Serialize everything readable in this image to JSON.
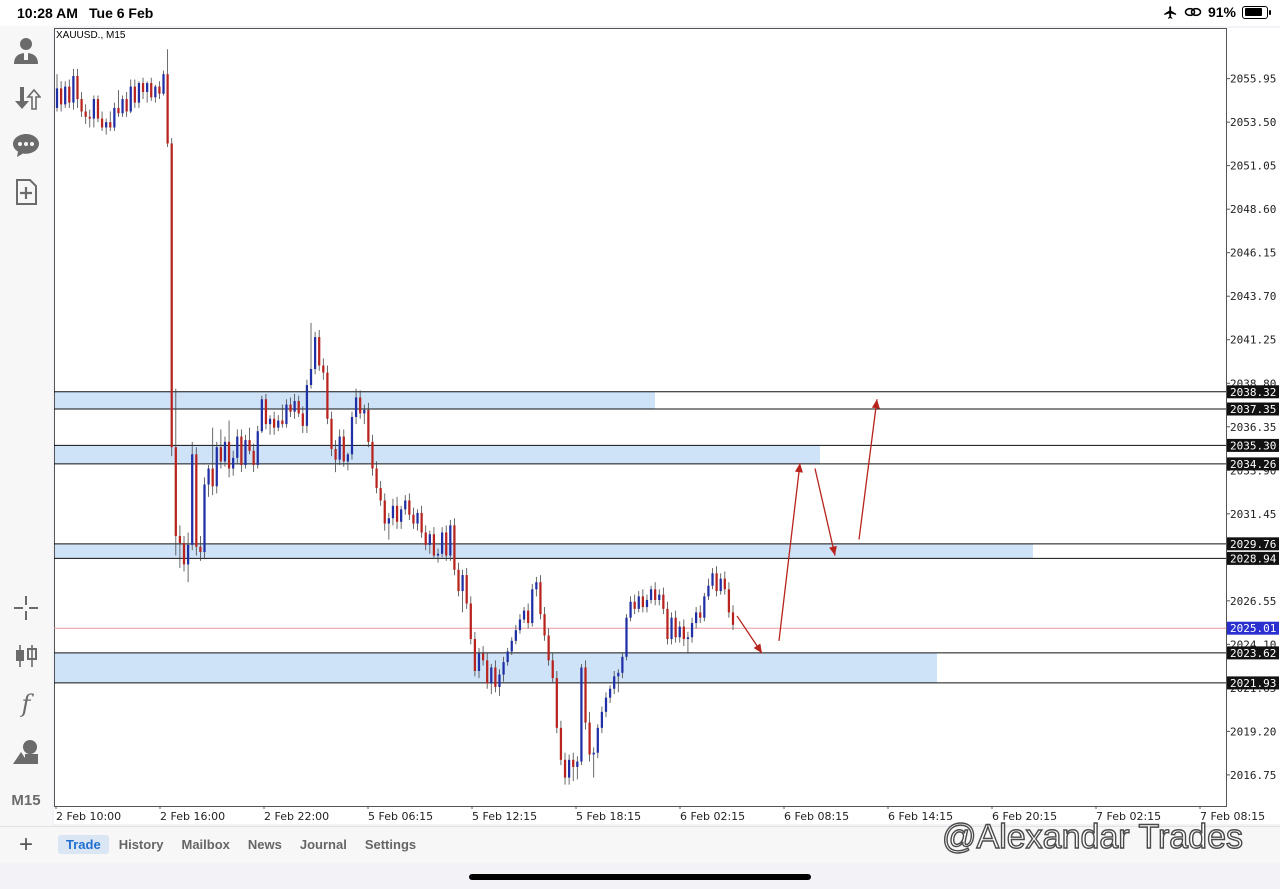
{
  "status_bar": {
    "time": "10:28 AM",
    "date": "Tue 6 Feb",
    "battery": "91%",
    "battery_level": 0.91
  },
  "sidebar": {
    "icons": [
      "account-icon",
      "trade-up-down-icon",
      "chat-icon",
      "new-order-icon",
      "crosshair-icon",
      "candles-icon",
      "indicators-icon",
      "objects-icon"
    ],
    "indicator_glyph": "f",
    "timeframe": "M15"
  },
  "chart_title": "XAUUSD., M15",
  "bottom_bar": {
    "plus": "+",
    "tabs": [
      "Trade",
      "History",
      "Mailbox",
      "News",
      "Journal",
      "Settings"
    ],
    "active_tab": "Trade"
  },
  "watermark": "@Alexandar Trades",
  "chart_data": {
    "type": "candlestick",
    "symbol": "XAUUSD., M15",
    "ylim": [
      2015.0,
      2058.8
    ],
    "y_ticks": [
      "2055.95",
      "2053.50",
      "2051.05",
      "2048.60",
      "2046.15",
      "2043.70",
      "2041.25",
      "2038.80",
      "2036.35",
      "2033.90",
      "2031.45",
      "2026.55",
      "2024.10",
      "2021.65",
      "2019.20",
      "2016.75"
    ],
    "x_ticks": [
      "2 Feb 10:00",
      "2 Feb 16:00",
      "2 Feb 22:00",
      "5 Feb 06:15",
      "5 Feb 12:15",
      "5 Feb 18:15",
      "6 Feb 02:15",
      "6 Feb 08:15",
      "6 Feb 14:15",
      "6 Feb 20:15",
      "7 Feb 02:15",
      "7 Feb 08:15"
    ],
    "current_price": 2025.01,
    "level_labels": [
      "2038.32",
      "2037.35",
      "2035.30",
      "2034.26",
      "2029.76",
      "2028.94",
      "2025.01",
      "2023.62",
      "2021.93"
    ],
    "zones": [
      {
        "top": 2038.32,
        "bottom": 2037.35
      },
      {
        "top": 2035.3,
        "bottom": 2034.26
      },
      {
        "top": 2029.76,
        "bottom": 2028.94
      },
      {
        "top": 2023.62,
        "bottom": 2021.93
      }
    ],
    "projected_path": [
      2025.7,
      2023.6,
      2024.3,
      2034.3,
      2031.1,
      2038.1
    ],
    "colors": {
      "bull": "#1f2fa6",
      "bear": "#b8231d",
      "zone": "#cfe3f8",
      "arrow": "#b8231d",
      "price_line": "#e79aa2",
      "price_badge": "#2b2fd0"
    },
    "candles": [
      [
        2054.3,
        2056.2,
        2054.1,
        2055.4
      ],
      [
        2055.4,
        2055.8,
        2054.1,
        2054.5
      ],
      [
        2054.5,
        2055.8,
        2054.3,
        2055.5
      ],
      [
        2055.5,
        2055.9,
        2054.3,
        2054.6
      ],
      [
        2054.6,
        2056.5,
        2054.2,
        2056.1
      ],
      [
        2056.1,
        2056.5,
        2054.3,
        2054.8
      ],
      [
        2054.8,
        2055.2,
        2053.8,
        2054.1
      ],
      [
        2054.1,
        2054.5,
        2053.4,
        2053.8
      ],
      [
        2053.8,
        2054.2,
        2053.2,
        2053.7
      ],
      [
        2053.7,
        2055.0,
        2053.2,
        2054.8
      ],
      [
        2054.8,
        2055.0,
        2053.5,
        2053.7
      ],
      [
        2053.7,
        2054.1,
        2053.0,
        2053.2
      ],
      [
        2053.2,
        2053.7,
        2052.8,
        2053.5
      ],
      [
        2053.5,
        2054.1,
        2053.0,
        2053.2
      ],
      [
        2053.2,
        2054.6,
        2053.0,
        2054.3
      ],
      [
        2054.3,
        2055.3,
        2053.8,
        2054.0
      ],
      [
        2054.0,
        2055.0,
        2053.8,
        2054.8
      ],
      [
        2054.8,
        2055.2,
        2053.8,
        2054.1
      ],
      [
        2054.1,
        2055.9,
        2054.0,
        2055.5
      ],
      [
        2055.5,
        2055.9,
        2054.3,
        2054.6
      ],
      [
        2054.6,
        2055.8,
        2054.3,
        2055.7
      ],
      [
        2055.7,
        2056.0,
        2054.8,
        2055.2
      ],
      [
        2055.2,
        2055.8,
        2054.6,
        2055.7
      ],
      [
        2055.7,
        2056.0,
        2054.7,
        2054.9
      ],
      [
        2054.9,
        2055.6,
        2054.6,
        2055.5
      ],
      [
        2055.5,
        2055.8,
        2054.8,
        2055.1
      ],
      [
        2055.1,
        2056.4,
        2055.0,
        2056.2
      ],
      [
        2056.2,
        2057.6,
        2052.1,
        2052.3
      ],
      [
        2052.3,
        2052.6,
        2034.7,
        2035.2
      ],
      [
        2035.2,
        2038.5,
        2029.1,
        2030.2
      ],
      [
        2030.2,
        2030.8,
        2028.4,
        2029.8
      ],
      [
        2029.8,
        2030.2,
        2028.2,
        2028.6
      ],
      [
        2028.6,
        2030.4,
        2027.6,
        2029.7
      ],
      [
        2029.7,
        2035.5,
        2029.4,
        2034.8
      ],
      [
        2034.8,
        2035.2,
        2029.1,
        2029.6
      ],
      [
        2029.6,
        2030.2,
        2028.8,
        2029.3
      ],
      [
        2029.3,
        2033.5,
        2028.9,
        2033.1
      ],
      [
        2033.1,
        2034.2,
        2032.4,
        2034.0
      ],
      [
        2034.0,
        2036.3,
        2032.5,
        2033.0
      ],
      [
        2033.0,
        2035.5,
        2032.6,
        2035.2
      ],
      [
        2035.2,
        2036.2,
        2034.0,
        2034.4
      ],
      [
        2034.4,
        2035.8,
        2034.1,
        2035.5
      ],
      [
        2035.5,
        2036.7,
        2033.5,
        2034.0
      ],
      [
        2034.0,
        2035.0,
        2033.6,
        2034.6
      ],
      [
        2034.6,
        2036.2,
        2034.3,
        2035.8
      ],
      [
        2035.8,
        2036.2,
        2033.8,
        2034.2
      ],
      [
        2034.2,
        2035.9,
        2034.0,
        2035.6
      ],
      [
        2035.6,
        2036.3,
        2034.8,
        2035.0
      ],
      [
        2035.0,
        2035.4,
        2033.8,
        2034.2
      ],
      [
        2034.2,
        2036.4,
        2034.0,
        2036.1
      ],
      [
        2036.1,
        2038.1,
        2036.0,
        2037.9
      ],
      [
        2037.9,
        2038.2,
        2036.2,
        2036.5
      ],
      [
        2036.5,
        2037.0,
        2035.9,
        2036.8
      ],
      [
        2036.8,
        2037.2,
        2035.9,
        2036.3
      ],
      [
        2036.3,
        2037.0,
        2036.1,
        2036.7
      ],
      [
        2036.7,
        2037.6,
        2036.3,
        2036.5
      ],
      [
        2036.5,
        2037.9,
        2036.3,
        2037.6
      ],
      [
        2037.6,
        2038.0,
        2036.9,
        2037.2
      ],
      [
        2037.2,
        2038.2,
        2036.8,
        2037.8
      ],
      [
        2037.8,
        2038.1,
        2036.9,
        2037.1
      ],
      [
        2037.1,
        2037.5,
        2036.0,
        2036.4
      ],
      [
        2036.4,
        2039.0,
        2036.0,
        2038.7
      ],
      [
        2038.7,
        2042.2,
        2038.5,
        2039.6
      ],
      [
        2039.6,
        2041.7,
        2039.3,
        2041.4
      ],
      [
        2041.4,
        2041.8,
        2039.5,
        2039.8
      ],
      [
        2039.8,
        2040.2,
        2039.0,
        2039.4
      ],
      [
        2039.4,
        2039.8,
        2036.5,
        2036.8
      ],
      [
        2036.8,
        2037.2,
        2034.7,
        2035.1
      ],
      [
        2035.1,
        2035.6,
        2033.8,
        2034.5
      ],
      [
        2034.5,
        2036.2,
        2034.2,
        2035.8
      ],
      [
        2035.8,
        2036.2,
        2034.1,
        2034.4
      ],
      [
        2034.4,
        2034.9,
        2033.9,
        2034.8
      ],
      [
        2034.8,
        2037.2,
        2034.5,
        2036.9
      ],
      [
        2036.9,
        2038.5,
        2036.5,
        2038.0
      ],
      [
        2038.0,
        2038.4,
        2036.8,
        2037.1
      ],
      [
        2037.1,
        2037.6,
        2036.5,
        2037.3
      ],
      [
        2037.3,
        2037.7,
        2035.2,
        2035.5
      ],
      [
        2035.5,
        2035.9,
        2033.6,
        2034.0
      ],
      [
        2034.0,
        2034.4,
        2032.6,
        2032.9
      ],
      [
        2032.9,
        2033.3,
        2031.9,
        2032.2
      ],
      [
        2032.2,
        2032.6,
        2030.5,
        2030.9
      ],
      [
        2030.9,
        2031.5,
        2030.0,
        2031.2
      ],
      [
        2031.2,
        2032.3,
        2030.8,
        2031.9
      ],
      [
        2031.9,
        2032.4,
        2030.6,
        2031.0
      ],
      [
        2031.0,
        2031.9,
        2030.6,
        2031.7
      ],
      [
        2031.7,
        2032.5,
        2031.4,
        2032.2
      ],
      [
        2032.2,
        2032.6,
        2031.1,
        2031.4
      ],
      [
        2031.4,
        2031.8,
        2030.6,
        2030.9
      ],
      [
        2030.9,
        2031.7,
        2030.5,
        2031.5
      ],
      [
        2031.5,
        2031.9,
        2030.1,
        2030.4
      ],
      [
        2030.4,
        2030.8,
        2029.4,
        2029.7
      ],
      [
        2029.7,
        2030.5,
        2029.2,
        2030.3
      ],
      [
        2030.3,
        2030.7,
        2028.9,
        2029.1
      ],
      [
        2029.1,
        2029.5,
        2028.7,
        2029.2
      ],
      [
        2029.2,
        2030.7,
        2029.0,
        2030.4
      ],
      [
        2030.4,
        2030.8,
        2028.8,
        2029.1
      ],
      [
        2029.1,
        2031.1,
        2028.8,
        2030.8
      ],
      [
        2030.8,
        2031.2,
        2028.0,
        2028.3
      ],
      [
        2028.3,
        2028.7,
        2026.8,
        2027.1
      ],
      [
        2027.1,
        2028.3,
        2025.9,
        2028.0
      ],
      [
        2028.0,
        2028.4,
        2026.1,
        2026.4
      ],
      [
        2026.4,
        2026.8,
        2024.1,
        2024.4
      ],
      [
        2024.4,
        2024.8,
        2022.3,
        2022.6
      ],
      [
        2022.6,
        2023.9,
        2022.2,
        2023.6
      ],
      [
        2023.6,
        2024.0,
        2022.9,
        2023.2
      ],
      [
        2023.2,
        2023.6,
        2021.6,
        2021.9
      ],
      [
        2021.9,
        2023.0,
        2021.3,
        2022.8
      ],
      [
        2022.8,
        2023.2,
        2021.4,
        2021.7
      ],
      [
        2021.7,
        2022.7,
        2021.2,
        2022.4
      ],
      [
        2022.4,
        2023.4,
        2022.0,
        2023.1
      ],
      [
        2023.1,
        2023.9,
        2022.9,
        2023.7
      ],
      [
        2023.7,
        2024.5,
        2023.5,
        2024.3
      ],
      [
        2024.3,
        2025.2,
        2024.1,
        2024.9
      ],
      [
        2024.9,
        2025.8,
        2024.7,
        2025.5
      ],
      [
        2025.5,
        2026.2,
        2025.3,
        2026.0
      ],
      [
        2026.0,
        2026.4,
        2025.0,
        2025.3
      ],
      [
        2025.3,
        2027.5,
        2025.1,
        2027.2
      ],
      [
        2027.2,
        2027.9,
        2026.8,
        2027.6
      ],
      [
        2027.6,
        2028.0,
        2025.5,
        2025.8
      ],
      [
        2025.8,
        2026.2,
        2024.3,
        2024.6
      ],
      [
        2024.6,
        2025.0,
        2022.9,
        2023.2
      ],
      [
        2023.2,
        2023.6,
        2021.9,
        2022.2
      ],
      [
        2022.2,
        2022.6,
        2019.1,
        2019.4
      ],
      [
        2019.4,
        2019.8,
        2017.3,
        2017.6
      ],
      [
        2017.6,
        2018.0,
        2016.2,
        2016.6
      ],
      [
        2016.6,
        2017.9,
        2016.2,
        2017.6
      ],
      [
        2017.6,
        2018.0,
        2016.4,
        2017.2
      ],
      [
        2017.2,
        2017.8,
        2016.5,
        2017.5
      ],
      [
        2017.5,
        2023.0,
        2017.3,
        2022.8
      ],
      [
        2022.8,
        2023.2,
        2019.3,
        2019.7
      ],
      [
        2019.7,
        2020.3,
        2017.5,
        2017.9
      ],
      [
        2017.9,
        2018.3,
        2016.6,
        2018.0
      ],
      [
        2018.0,
        2019.6,
        2017.7,
        2019.4
      ],
      [
        2019.4,
        2020.6,
        2019.1,
        2020.3
      ],
      [
        2020.3,
        2021.4,
        2020.0,
        2021.1
      ],
      [
        2021.1,
        2021.8,
        2020.8,
        2021.6
      ],
      [
        2021.6,
        2022.6,
        2021.3,
        2022.3
      ],
      [
        2022.3,
        2022.7,
        2021.4,
        2022.5
      ],
      [
        2022.5,
        2023.6,
        2022.2,
        2023.4
      ],
      [
        2023.4,
        2025.8,
        2023.2,
        2025.6
      ],
      [
        2025.6,
        2026.8,
        2025.4,
        2026.5
      ],
      [
        2026.5,
        2026.9,
        2025.8,
        2026.1
      ],
      [
        2026.1,
        2027.1,
        2025.9,
        2026.8
      ],
      [
        2026.8,
        2027.2,
        2025.9,
        2026.2
      ],
      [
        2026.2,
        2026.9,
        2025.9,
        2026.6
      ],
      [
        2026.6,
        2027.4,
        2026.4,
        2027.2
      ],
      [
        2027.2,
        2027.6,
        2026.3,
        2026.6
      ],
      [
        2026.6,
        2027.2,
        2026.3,
        2026.9
      ],
      [
        2026.9,
        2027.3,
        2025.8,
        2026.1
      ],
      [
        2026.1,
        2026.5,
        2024.1,
        2024.4
      ],
      [
        2024.4,
        2025.9,
        2024.1,
        2025.6
      ],
      [
        2025.6,
        2026.0,
        2024.2,
        2024.5
      ],
      [
        2024.5,
        2025.4,
        2024.2,
        2025.1
      ],
      [
        2025.1,
        2025.5,
        2024.0,
        2024.4
      ],
      [
        2024.4,
        2024.8,
        2023.6,
        2024.5
      ],
      [
        2024.5,
        2025.6,
        2024.2,
        2025.3
      ],
      [
        2025.3,
        2026.2,
        2025.0,
        2025.9
      ],
      [
        2025.9,
        2026.3,
        2025.3,
        2025.6
      ],
      [
        2025.6,
        2027.0,
        2025.4,
        2026.8
      ],
      [
        2026.8,
        2027.8,
        2026.6,
        2027.4
      ],
      [
        2027.4,
        2028.4,
        2027.2,
        2028.1
      ],
      [
        2028.1,
        2028.5,
        2026.8,
        2027.1
      ],
      [
        2027.1,
        2028.1,
        2026.9,
        2027.8
      ],
      [
        2027.8,
        2028.2,
        2026.9,
        2027.2
      ],
      [
        2027.2,
        2027.6,
        2025.6,
        2025.9
      ],
      [
        2025.9,
        2026.3,
        2024.9,
        2025.2
      ]
    ]
  }
}
